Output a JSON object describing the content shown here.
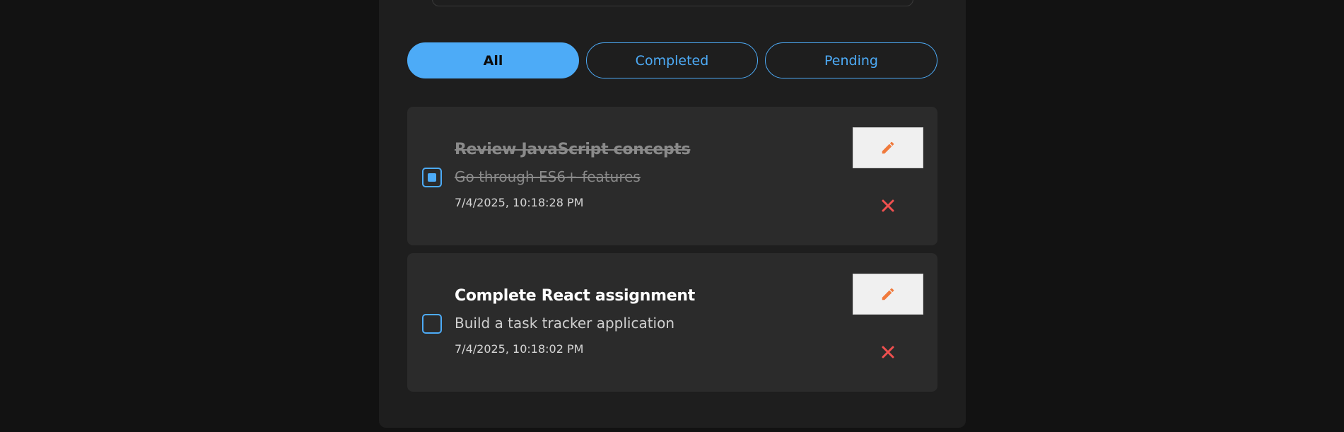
{
  "filters": {
    "all_label": "All",
    "completed_label": "Completed",
    "pending_label": "Pending",
    "active": "All"
  },
  "tasks": [
    {
      "title": "Review JavaScript concepts",
      "description": "Go through ES6+ features",
      "timestamp": "7/4/2025, 10:18:28 PM",
      "completed": true,
      "edit_icon": "pencil-icon",
      "delete_icon": "close-icon"
    },
    {
      "title": "Complete React assignment",
      "description": "Build a task tracker application",
      "timestamp": "7/4/2025, 10:18:02 PM",
      "completed": false,
      "edit_icon": "pencil-icon",
      "delete_icon": "close-icon"
    }
  ],
  "colors": {
    "accent": "#4dabf7",
    "edit_icon": "#f07a3c",
    "delete_icon": "#f0504f",
    "background": "#121212",
    "panel": "#1e1e1e",
    "card": "#2b2b2b"
  }
}
